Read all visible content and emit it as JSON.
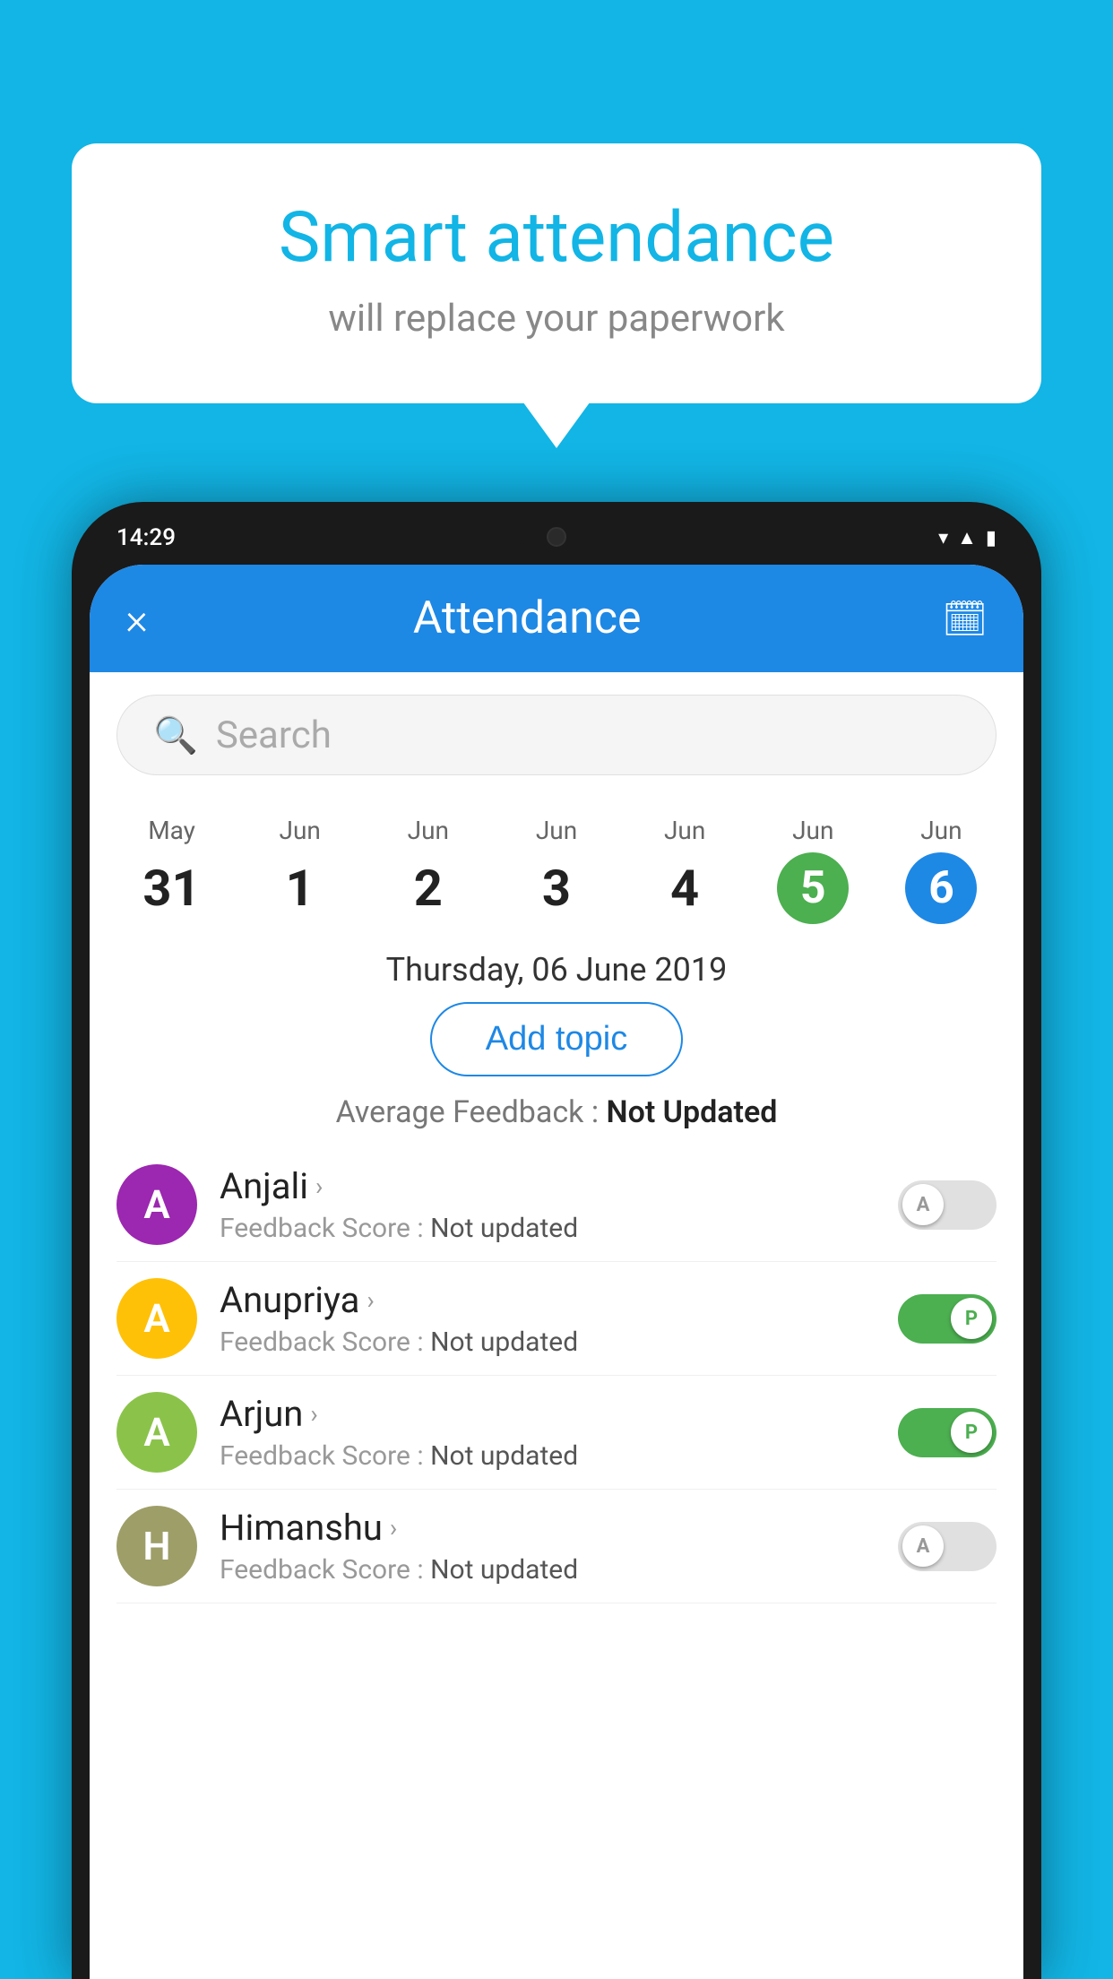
{
  "background_color": "#12B5E5",
  "bubble": {
    "title": "Smart attendance",
    "subtitle": "will replace your paperwork"
  },
  "status_bar": {
    "time": "14:29",
    "icons": [
      "wifi",
      "signal",
      "battery"
    ]
  },
  "header": {
    "close_label": "×",
    "title": "Attendance",
    "calendar_icon": "📅"
  },
  "search": {
    "placeholder": "Search"
  },
  "dates": [
    {
      "month": "May",
      "day": "31",
      "style": "normal"
    },
    {
      "month": "Jun",
      "day": "1",
      "style": "normal"
    },
    {
      "month": "Jun",
      "day": "2",
      "style": "normal"
    },
    {
      "month": "Jun",
      "day": "3",
      "style": "normal"
    },
    {
      "month": "Jun",
      "day": "4",
      "style": "normal"
    },
    {
      "month": "Jun",
      "day": "5",
      "style": "green"
    },
    {
      "month": "Jun",
      "day": "6",
      "style": "blue"
    }
  ],
  "selected_date": "Thursday, 06 June 2019",
  "add_topic_label": "Add topic",
  "avg_feedback_label": "Average Feedback :",
  "avg_feedback_value": "Not Updated",
  "students": [
    {
      "name": "Anjali",
      "avatar_letter": "A",
      "avatar_color": "purple",
      "feedback_label": "Feedback Score :",
      "feedback_value": "Not updated",
      "toggle": "off",
      "toggle_letter": "A"
    },
    {
      "name": "Anupriya",
      "avatar_letter": "A",
      "avatar_color": "yellow",
      "feedback_label": "Feedback Score :",
      "feedback_value": "Not updated",
      "toggle": "on",
      "toggle_letter": "P"
    },
    {
      "name": "Arjun",
      "avatar_letter": "A",
      "avatar_color": "light-green",
      "feedback_label": "Feedback Score :",
      "feedback_value": "Not updated",
      "toggle": "on",
      "toggle_letter": "P"
    },
    {
      "name": "Himanshu",
      "avatar_letter": "H",
      "avatar_color": "khaki",
      "feedback_label": "Feedback Score :",
      "feedback_value": "Not updated",
      "toggle": "off",
      "toggle_letter": "A"
    }
  ]
}
